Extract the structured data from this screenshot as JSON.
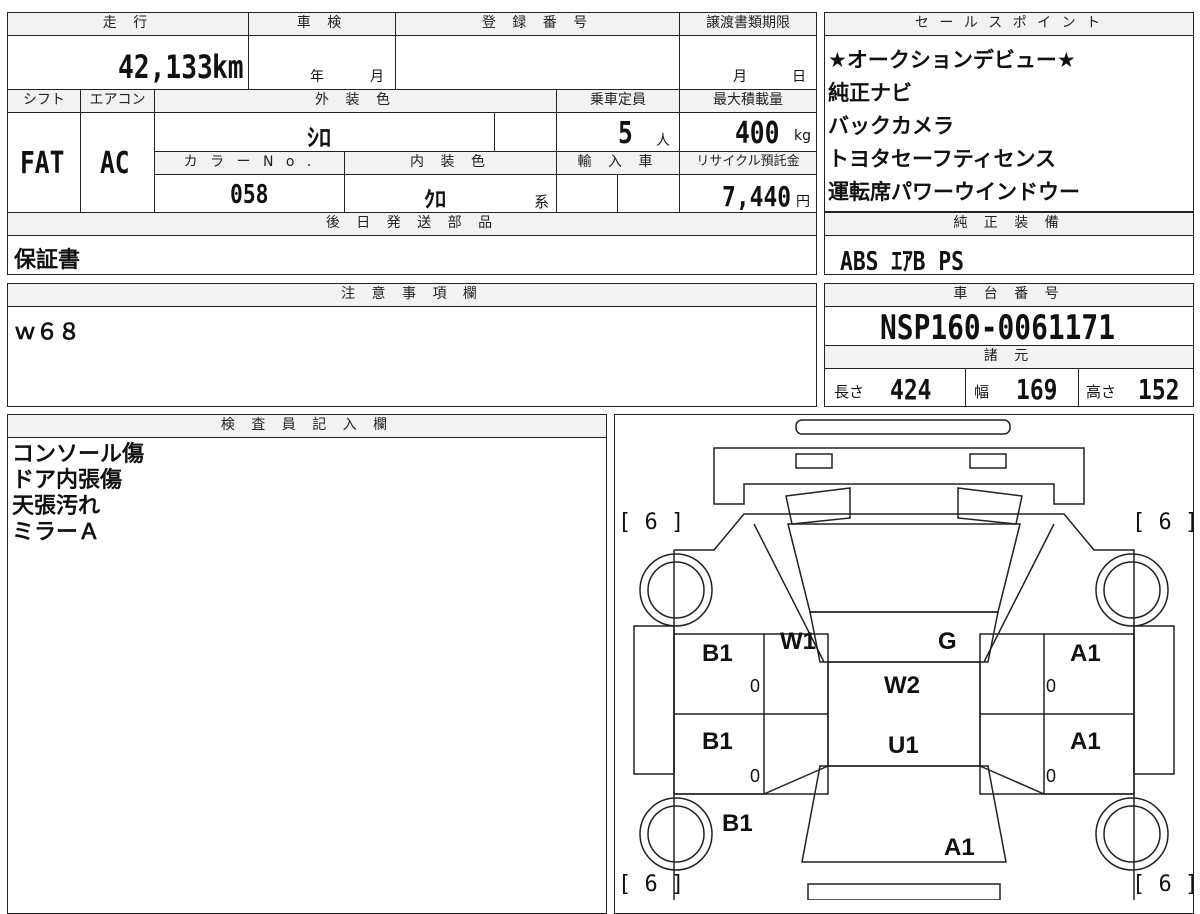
{
  "labels": {
    "mileage": "走 行",
    "shaken": "車 検",
    "reg_no": "登 録 番 号",
    "transfer_deadline": "譲渡書類期限",
    "sales_points": "セ ー ル ス ポ イ ン ト",
    "shift": "シフト",
    "aircon": "エアコン",
    "exterior_color": "外 装 色",
    "capacity": "乗車定員",
    "max_load": "最大積載量",
    "color_no": "カ ラ ー N o .",
    "interior_color": "内 装 色",
    "import": "輸 入 車",
    "recycle": "リサイクル預託金",
    "later_parts": "後 日 発 送 部 品",
    "genuine_equipment": "純 正 装 備",
    "notes": "注 意 事 項 欄",
    "chassis_no": "車 台 番 号",
    "specs": "諸 元",
    "inspector": "検 査 員 記 入 欄"
  },
  "values": {
    "mileage": "42,133",
    "mileage_unit": "km",
    "year_unit": "年",
    "month_unit": "月",
    "deadline_month": "月",
    "deadline_day": "日",
    "shift": "FAT",
    "aircon": "AC",
    "exterior_color": "ｼﾛ",
    "capacity": "5",
    "capacity_unit": "人",
    "max_load": "400",
    "max_load_unit": "kg",
    "color_no": "058",
    "interior_color": "ｸﾛ",
    "interior_suffix": "系",
    "recycle": "7,440",
    "recycle_unit": "円",
    "later_parts": "保証書",
    "genuine_equipment": "ABS ｴｱB PS",
    "notes": "ｗ６８",
    "chassis_no": "NSP160-0061171",
    "length_label": "長さ",
    "length": "424",
    "width_label": "幅",
    "width": "169",
    "height_label": "高さ",
    "height": "152"
  },
  "sales_points": [
    "★オークションデビュー★",
    "純正ナビ",
    "バックカメラ",
    "トヨタセーフティセンス",
    "運転席パワーウインドウー"
  ],
  "inspector_notes": [
    "コンソール傷",
    "ドア内張傷",
    "天張汚れ",
    "ミラーＡ"
  ],
  "diagram": {
    "tire_tl": "[ 6 ]",
    "tire_tr": "[ 6 ]",
    "tire_bl": "[ 6 ]",
    "tire_br": "[ 6 ]",
    "front_left_door": "B1",
    "front_left_door_sub": "0",
    "rear_left_door": "B1",
    "rear_left_door_sub": "0",
    "left_rear_fender": "B1",
    "front_right_door": "A1",
    "front_right_door_sub": "0",
    "rear_right_door": "A1",
    "rear_right_door_sub": "0",
    "right_rear_fender": "A1",
    "windshield": "W1",
    "windshield_glass": "G",
    "roof": "W2",
    "roof_rear": "U1"
  }
}
